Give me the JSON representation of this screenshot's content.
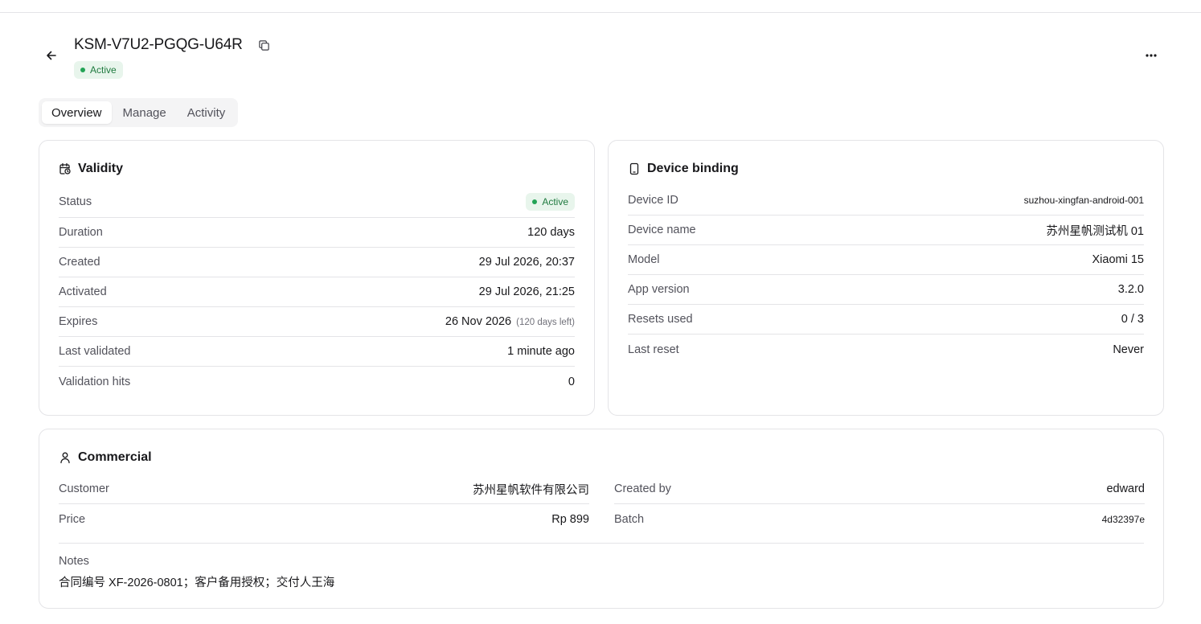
{
  "header": {
    "title": "KSM-V7U2-PGQG-U64R",
    "status": "Active",
    "back_icon": "arrow-left-icon",
    "copy_icon": "copy-icon",
    "more_icon": "more-horizontal-icon"
  },
  "tabs": [
    {
      "label": "Overview",
      "active": true
    },
    {
      "label": "Manage",
      "active": false
    },
    {
      "label": "Activity",
      "active": false
    }
  ],
  "validity": {
    "title": "Validity",
    "icon": "calendar-clock-icon",
    "status_label": "Status",
    "status_value": "Active",
    "rows": [
      {
        "label": "Duration",
        "value": "120 days"
      },
      {
        "label": "Created",
        "value": "29 Jul 2026, 20:37"
      },
      {
        "label": "Activated",
        "value": "29 Jul 2026, 21:25"
      },
      {
        "label": "Expires",
        "value": "26 Nov 2026",
        "sub": "(120 days left)"
      },
      {
        "label": "Last validated",
        "value": "1 minute ago"
      },
      {
        "label": "Validation hits",
        "value": "0"
      }
    ]
  },
  "device": {
    "title": "Device binding",
    "icon": "smartphone-icon",
    "rows": [
      {
        "label": "Device ID",
        "value": "suzhou-xingfan-android-001"
      },
      {
        "label": "Device name",
        "value": "苏州星帆测试机 01"
      },
      {
        "label": "Model",
        "value": "Xiaomi 15"
      },
      {
        "label": "App version",
        "value": "3.2.0"
      },
      {
        "label": "Resets used",
        "value": "0 / 3"
      },
      {
        "label": "Last reset",
        "value": "Never"
      }
    ]
  },
  "commercial": {
    "title": "Commercial",
    "icon": "user-icon",
    "left": [
      {
        "label": "Customer",
        "value": "苏州星帆软件有限公司"
      },
      {
        "label": "Price",
        "value": "Rp 899"
      }
    ],
    "right": [
      {
        "label": "Created by",
        "value": "edward"
      },
      {
        "label": "Batch",
        "value": "4d32397e"
      }
    ],
    "notes_label": "Notes",
    "notes_value": "合同编号 XF-2026-0801；客户备用授权；交付人王海"
  },
  "colors": {
    "status_bg": "#e8f5ec",
    "status_text": "#1f7a3f",
    "status_dot": "#22a355",
    "border": "#e4e4e7"
  }
}
